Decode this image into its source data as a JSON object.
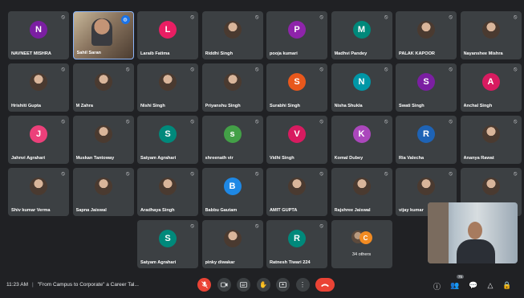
{
  "participants": [
    {
      "name": "NAVNEET MISHRA",
      "initial": "N",
      "color": "#7b1fa2",
      "type": "initial"
    },
    {
      "name": "Sahil Saran",
      "initial": "",
      "color": "",
      "type": "video"
    },
    {
      "name": "Laraib Fatima",
      "initial": "L",
      "color": "#e91e63",
      "type": "initial"
    },
    {
      "name": "Riddhi Singh",
      "initial": "",
      "color": "",
      "type": "photo"
    },
    {
      "name": "pooja kumari",
      "initial": "P",
      "color": "#8e24aa",
      "type": "initial"
    },
    {
      "name": "Madhvi Pandey",
      "initial": "M",
      "color": "#00897b",
      "type": "initial"
    },
    {
      "name": "PALAK KAPOOR",
      "initial": "",
      "color": "",
      "type": "photo"
    },
    {
      "name": "Nayanshee Mishra",
      "initial": "",
      "color": "",
      "type": "photo"
    },
    {
      "name": "Hrishiti Gupta",
      "initial": "",
      "color": "",
      "type": "photo"
    },
    {
      "name": "M Zahra",
      "initial": "",
      "color": "",
      "type": "photo"
    },
    {
      "name": "Nishi Singh",
      "initial": "",
      "color": "",
      "type": "photo"
    },
    {
      "name": "Priyanshu Singh",
      "initial": "",
      "color": "",
      "type": "photo"
    },
    {
      "name": "Surabhi Singh",
      "initial": "S",
      "color": "#e8581c",
      "type": "initial"
    },
    {
      "name": "Nisha Shukla",
      "initial": "N",
      "color": "#0097a7",
      "type": "initial"
    },
    {
      "name": "Swati Singh",
      "initial": "S",
      "color": "#7b1fa2",
      "type": "initial"
    },
    {
      "name": "Anchal Singh",
      "initial": "A",
      "color": "#d81b60",
      "type": "initial"
    },
    {
      "name": "Jahnvi Agrahari",
      "initial": "J",
      "color": "#ec407a",
      "type": "initial"
    },
    {
      "name": "Muskan Tantoway",
      "initial": "",
      "color": "",
      "type": "photo"
    },
    {
      "name": "Satyam Agrahari",
      "initial": "S",
      "color": "#00897b",
      "type": "initial"
    },
    {
      "name": "shreenath vir",
      "initial": "s",
      "color": "#43a047",
      "type": "initial"
    },
    {
      "name": "Vidhi Singh",
      "initial": "V",
      "color": "#d81b60",
      "type": "initial"
    },
    {
      "name": "Komal Dubey",
      "initial": "K",
      "color": "#ab47bc",
      "type": "initial"
    },
    {
      "name": "Ria Valecha",
      "initial": "R",
      "color": "#1e63b5",
      "type": "initial"
    },
    {
      "name": "Ananya Rawat",
      "initial": "",
      "color": "",
      "type": "photo"
    },
    {
      "name": "Shiv kumar Verma",
      "initial": "",
      "color": "",
      "type": "photo"
    },
    {
      "name": "Sapna Jaiswal",
      "initial": "",
      "color": "",
      "type": "photo"
    },
    {
      "name": "Aradhaya Singh",
      "initial": "",
      "color": "",
      "type": "photo"
    },
    {
      "name": "Babbu Gautam",
      "initial": "B",
      "color": "#1e88e5",
      "type": "initial"
    },
    {
      "name": "AMIT GUPTA",
      "initial": "",
      "color": "",
      "type": "photo"
    },
    {
      "name": "Rajshree Jaiswal",
      "initial": "",
      "color": "",
      "type": "photo"
    },
    {
      "name": "vijay kumar",
      "initial": "",
      "color": "",
      "type": "photo"
    },
    {
      "name": "",
      "initial": "",
      "color": "",
      "type": "photo"
    },
    {
      "name": "",
      "initial": "",
      "color": "",
      "type": "empty"
    },
    {
      "name": "",
      "initial": "",
      "color": "",
      "type": "empty"
    },
    {
      "name": "Satyam Agrahari",
      "initial": "S",
      "color": "#00897b",
      "type": "initial"
    },
    {
      "name": "pinky diwakar",
      "initial": "",
      "color": "",
      "type": "photo"
    },
    {
      "name": "Ratnesh Tiwari 224",
      "initial": "R",
      "color": "#00897b",
      "type": "initial"
    },
    {
      "name": "34 others",
      "initial": "",
      "color": "",
      "type": "others"
    }
  ],
  "others_avatar_initial": "C",
  "bottom_bar": {
    "time": "11:23 AM",
    "meeting_title": "\"From Campus to Corporate\" a Career Tal...",
    "participant_count": "75"
  },
  "icons": {
    "mic": "mic-off-icon",
    "camera": "camera-icon",
    "captions": "captions-icon",
    "hand": "raise-hand-icon",
    "present": "present-icon",
    "more": "more-options-icon",
    "end": "end-call-icon",
    "info": "info-icon",
    "people": "people-icon",
    "chat": "chat-icon",
    "activities": "activities-icon",
    "host": "host-controls-icon"
  },
  "colors": {
    "end_call": "#ea4335",
    "background": "#202124",
    "tile": "#3c4043"
  }
}
